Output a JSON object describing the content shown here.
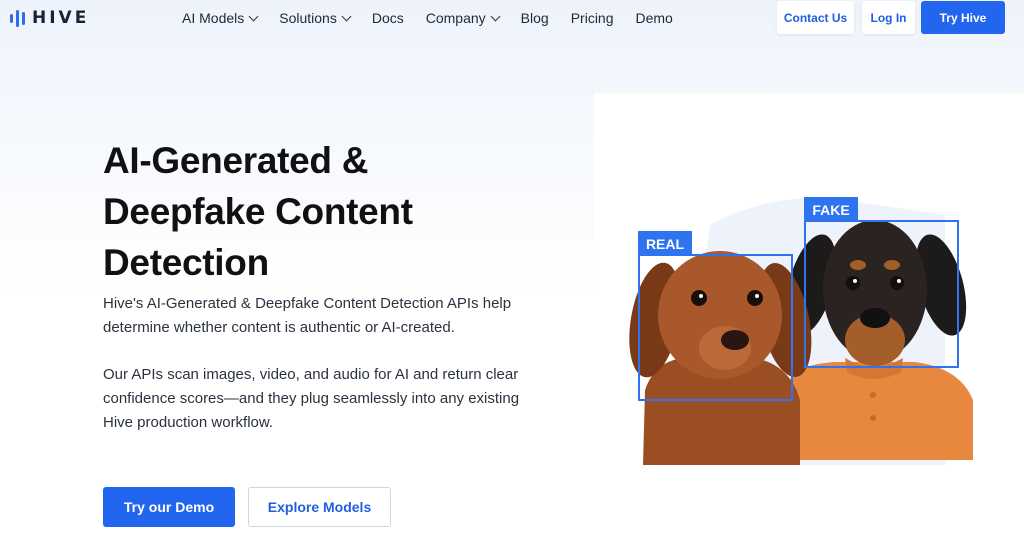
{
  "brand": {
    "name": "HIVE",
    "accent": "#2266f0"
  },
  "nav": {
    "menu": [
      {
        "label": "AI Models",
        "dropdown": true
      },
      {
        "label": "Solutions",
        "dropdown": true
      },
      {
        "label": "Docs",
        "dropdown": false
      },
      {
        "label": "Company",
        "dropdown": true
      },
      {
        "label": "Blog",
        "dropdown": false
      },
      {
        "label": "Pricing",
        "dropdown": false
      },
      {
        "label": "Demo",
        "dropdown": false
      }
    ],
    "contact_label": "Contact Us",
    "login_label": "Log In",
    "try_label": "Try Hive"
  },
  "hero": {
    "title_lines": [
      "AI-Generated &",
      "Deepfake Content",
      "Detection"
    ],
    "paragraph_1": "Hive's AI-Generated & Deepfake Content Detection APIs help determine whether content is authentic or AI-created.",
    "paragraph_2": "Our APIs scan images, video, and audio for AI and return clear confidence scores—and they plug seamlessly into any existing Hive production workflow.",
    "demo_button": "Try our Demo",
    "models_button": "Explore Models"
  },
  "illustration": {
    "real_label": "REAL",
    "fake_label": "FAKE",
    "box_color": "#2e73f0"
  }
}
